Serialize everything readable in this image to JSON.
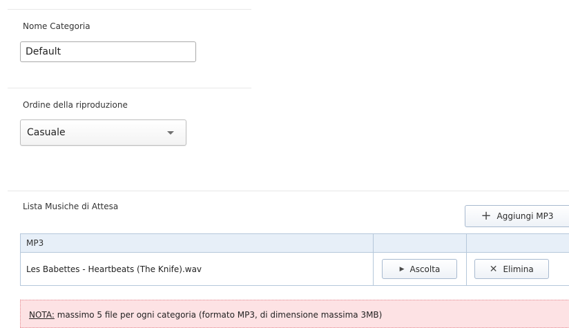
{
  "category": {
    "label": "Nome Categoria",
    "value": "Default"
  },
  "playback_order": {
    "label": "Ordine della riproduzione",
    "selected": "Casuale"
  },
  "playlist": {
    "label": "Lista Musiche di Attesa",
    "add_button": "Aggiungi MP3",
    "table": {
      "columns": [
        "MP3",
        "",
        ""
      ],
      "rows": [
        {
          "name": "Les Babettes - Heartbeats (The Knife).wav",
          "play_label": "Ascolta",
          "delete_label": "Elimina"
        }
      ]
    }
  },
  "note": {
    "prefix": "NOTA:",
    "text": " massimo 5 file per ogni categoria (formato MP3, di dimensione massima 3MB)"
  },
  "icons": {
    "add": "plus-icon",
    "play": "play-icon",
    "delete": "close-icon",
    "dropdown": "chevron-down-icon"
  },
  "colors": {
    "table_border": "#b5c7da",
    "table_header_bg": "#e7eff8",
    "note_bg": "#fde2e4",
    "note_border": "#e3868d"
  }
}
